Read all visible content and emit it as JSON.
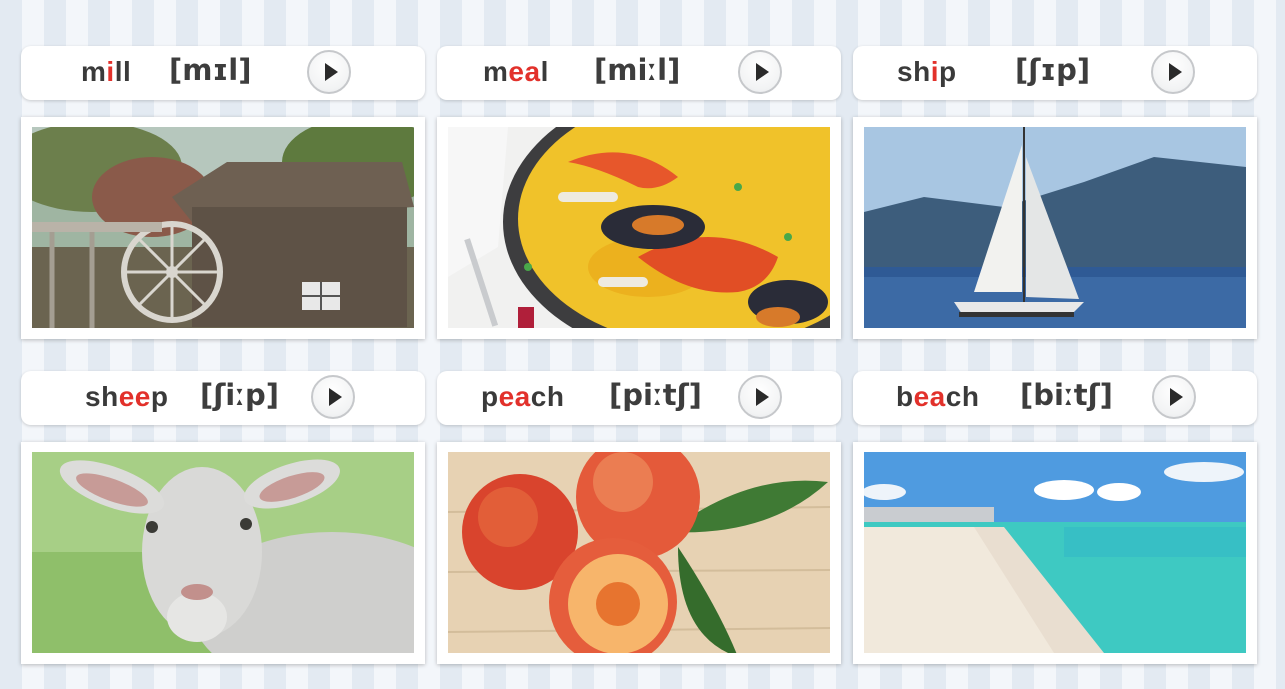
{
  "cards": [
    {
      "word_parts": [
        "m",
        "i",
        "ll"
      ],
      "ipa": "[mɪl]",
      "image": "watermill photo",
      "play_icon": "play-icon"
    },
    {
      "word_parts": [
        "m",
        "ea",
        "l"
      ],
      "ipa": "[miːl]",
      "image": "seafood paella photo",
      "play_icon": "play-icon"
    },
    {
      "word_parts": [
        "sh",
        "i",
        "p"
      ],
      "ipa": "[ʃɪp]",
      "image": "sailboat photo",
      "play_icon": "play-icon"
    },
    {
      "word_parts": [
        "sh",
        "ee",
        "p"
      ],
      "ipa": "[ʃiːp]",
      "image": "sheep photo",
      "play_icon": "play-icon"
    },
    {
      "word_parts": [
        "p",
        "ea",
        "ch"
      ],
      "ipa": "[piːtʃ]",
      "image": "peaches photo",
      "play_icon": "play-icon"
    },
    {
      "word_parts": [
        "b",
        "ea",
        "ch"
      ],
      "ipa": "[biːtʃ]",
      "image": "beach photo",
      "play_icon": "play-icon"
    }
  ],
  "colors": {
    "highlight": "#e2312b",
    "text": "#3a3a3a",
    "stripe_dark": "#e3eaf2",
    "stripe_light": "#f3f6fa"
  }
}
